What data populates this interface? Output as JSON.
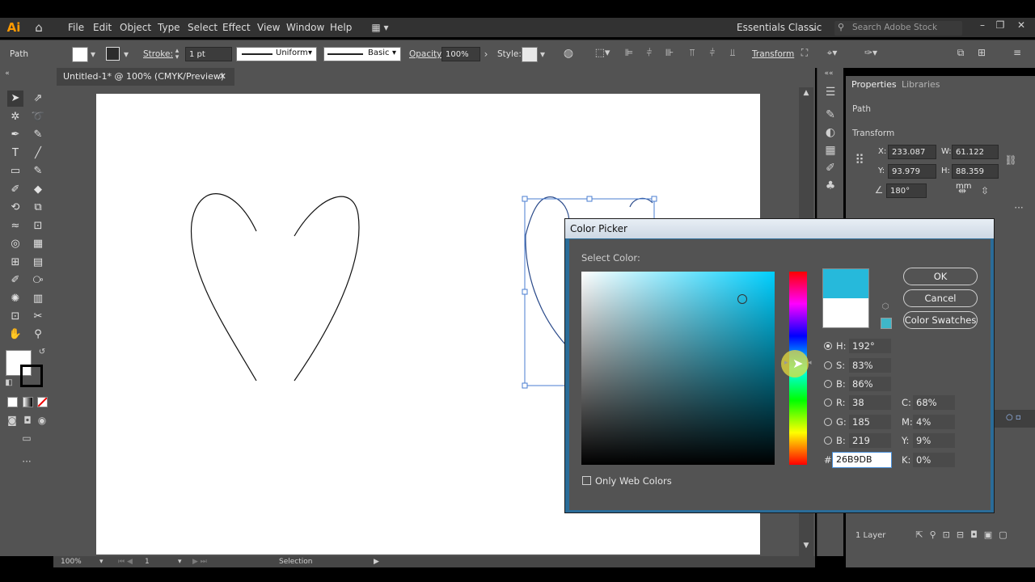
{
  "app": {
    "logo": "Ai"
  },
  "menu": [
    "File",
    "Edit",
    "Object",
    "Type",
    "Select",
    "Effect",
    "View",
    "Window",
    "Help"
  ],
  "workspace": "Essentials Classic",
  "search_placeholder": "Search Adobe Stock",
  "control": {
    "object_type": "Path",
    "stroke_label": "Stroke:",
    "stroke_weight": "1 pt",
    "profile": "Uniform",
    "brush": "Basic",
    "opacity_label": "Opacity:",
    "opacity": "100%",
    "style_label": "Style:",
    "transform_label": "Transform"
  },
  "document": {
    "tab_title": "Untitled-1* @ 100% (CMYK/Preview)",
    "zoom": "100%",
    "artboard_num": "1",
    "status_tool": "Selection"
  },
  "properties": {
    "tab_properties": "Properties",
    "tab_libraries": "Libraries",
    "section_path": "Path",
    "section_transform": "Transform",
    "x_label": "X:",
    "x": "233.087 mr",
    "y_label": "Y:",
    "y": "93.979 mm",
    "w_label": "W:",
    "w": "61.122 mm",
    "h_label": "H:",
    "h": "88.359 mm",
    "angle": "180°",
    "layers": "1 Layer"
  },
  "color_picker": {
    "title": "Color Picker",
    "select_color": "Select Color:",
    "ok": "OK",
    "cancel": "Cancel",
    "swatches": "Color Swatches",
    "h_label": "H:",
    "h": "192°",
    "s_label": "S:",
    "s": "83%",
    "b_label": "B:",
    "b": "86%",
    "r_label": "R:",
    "r": "38",
    "g_label": "G:",
    "g": "185",
    "bl_label": "B:",
    "bl": "219",
    "c_label": "C:",
    "c": "68%",
    "m_label": "M:",
    "m": "4%",
    "yy_label": "Y:",
    "yy": "9%",
    "k_label": "K:",
    "k": "0%",
    "hex_label": "#",
    "hex": "26B9DB",
    "only_web": "Only Web Colors",
    "new_color": "#26B9DB",
    "old_color": "#FFFFFF",
    "hue_color": "#00CFFF"
  }
}
